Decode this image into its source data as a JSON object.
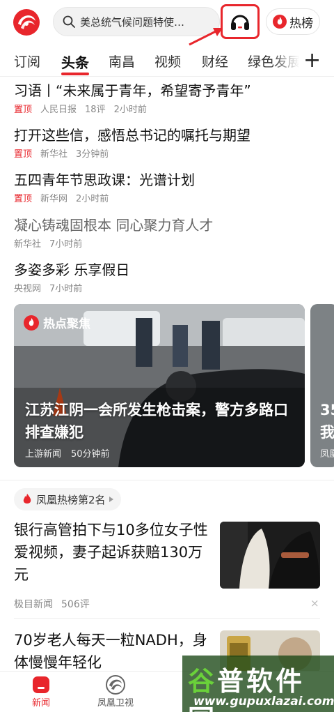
{
  "header": {
    "search_placeholder": "美总统气候问题特使…",
    "hot_button_label": "热榜"
  },
  "tabs": [
    {
      "label": "订阅"
    },
    {
      "label": "头条",
      "active": true
    },
    {
      "label": "南昌"
    },
    {
      "label": "视频"
    },
    {
      "label": "财经"
    },
    {
      "label": "绿色发展"
    }
  ],
  "news": [
    {
      "title": "习语丨“未来属于青年，希望寄予青年”",
      "pinned": "置顶",
      "source": "人民日报",
      "comments": "18评",
      "time": "2小时前"
    },
    {
      "title": "打开这些信，感悟总书记的嘱托与期望",
      "pinned": "置顶",
      "source": "新华社",
      "time": "3分钟前"
    },
    {
      "title": "五四青年节思政课：光谱计划",
      "pinned": "置顶",
      "source": "新华网",
      "time": "2小时前"
    },
    {
      "title": "凝心铸魂固根本 同心聚力育人才",
      "source": "新华社",
      "time": "7小时前"
    },
    {
      "title": "多姿多彩 乐享假日",
      "source": "央视网",
      "time": "7小时前"
    }
  ],
  "hot_card": {
    "badge": "热点聚焦",
    "title": "江苏江阴一会所发生枪击案，警方多路口排查嫌犯",
    "source": "上游新闻",
    "time": "50分钟前",
    "next_title_partial": "35\n我",
    "next_source_partial": "凤凰"
  },
  "rank_pill": "凤凰热榜第2名",
  "stories": [
    {
      "title": "银行高管拍下与10多位女子性爱视频，妻子起诉获赔130万元",
      "source": "极目新闻",
      "comments": "506评",
      "close": "×"
    },
    {
      "title": "70岁老人每天一粒NADH，身体慢慢年轻化"
    }
  ],
  "bottom_nav": [
    {
      "label": "新闻",
      "active": true
    },
    {
      "label": "凤凰卫视"
    }
  ],
  "watermark": {
    "big": "谷普软件园",
    "small": "www.gupuxlazai.com"
  },
  "colors": {
    "accent": "#e8262c"
  }
}
